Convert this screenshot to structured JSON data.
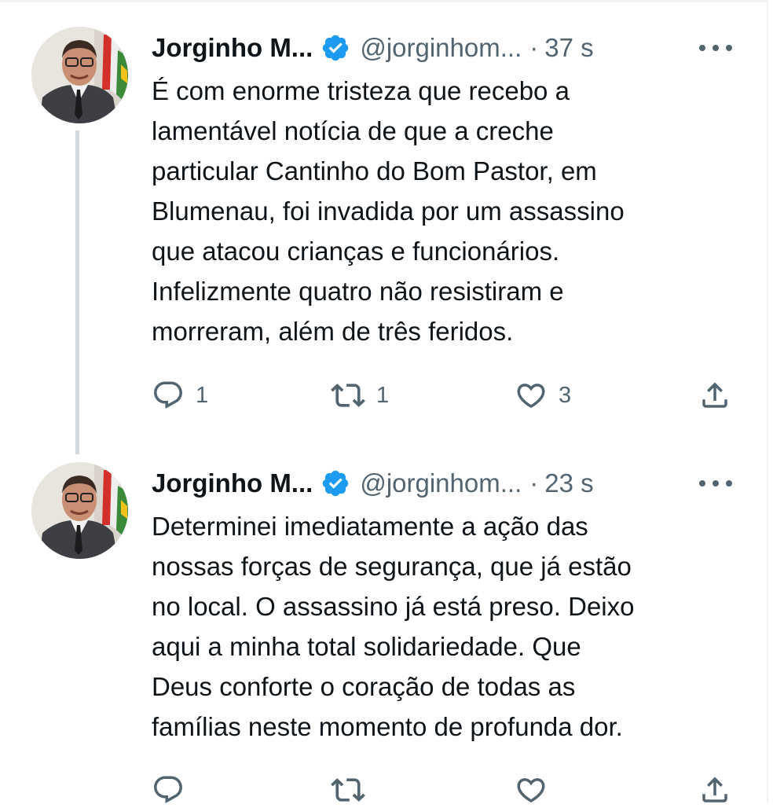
{
  "tweets": [
    {
      "author_name": "Jorginho M...",
      "handle": "@jorginhom...",
      "separator": "·",
      "time": "37 s",
      "lines": [
        "É com enorme tristeza que recebo a",
        "lamentável notícia de que a creche",
        "particular Cantinho do Bom Pastor, em",
        "Blumenau, foi invadida por um assassino",
        "que atacou crianças e funcionários.",
        "Infelizmente quatro não resistiram e",
        "morreram, além de três feridos."
      ],
      "reply_count": "1",
      "retweet_count": "1",
      "like_count": "3"
    },
    {
      "author_name": "Jorginho M...",
      "handle": "@jorginhom...",
      "separator": "·",
      "time": "23 s",
      "lines": [
        "Determinei imediatamente a ação das",
        "nossas forças de segurança, que já estão",
        "no local. O assassino já está preso. Deixo",
        "aqui a minha total solidariedade. Que",
        "Deus conforte o coração de todas as",
        "famílias neste momento de profunda dor."
      ],
      "reply_count": "",
      "retweet_count": "",
      "like_count": ""
    }
  ],
  "icons": {
    "verified": "verified-badge-icon",
    "more": "more-options-icon",
    "reply": "reply-icon",
    "retweet": "retweet-icon",
    "like": "like-icon",
    "share": "share-icon"
  },
  "colors": {
    "verified_blue": "#1d9bf0",
    "text": "#0f1419",
    "secondary": "#536471",
    "thread_line": "#cfd9de"
  }
}
